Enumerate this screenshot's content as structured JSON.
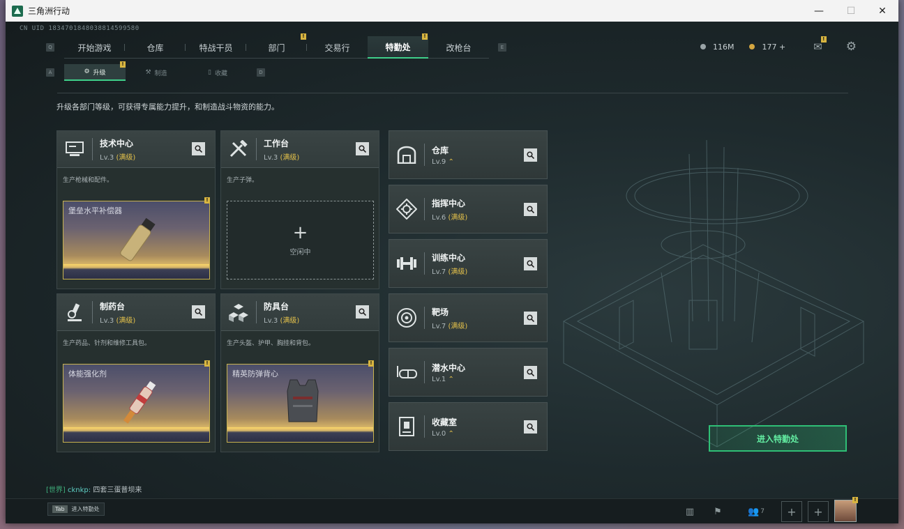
{
  "window": {
    "title": "三角洲行动"
  },
  "uid": "CN UID 1834701848038814599580",
  "nav": {
    "items": [
      {
        "label": "开始游戏"
      },
      {
        "label": "仓库"
      },
      {
        "label": "特战干员"
      },
      {
        "label": "部门"
      },
      {
        "label": "交易行"
      },
      {
        "label": "特勤处"
      },
      {
        "label": "改枪台"
      }
    ],
    "key_left": "Q",
    "key_right": "E"
  },
  "subnav": {
    "items": [
      {
        "label": "升级"
      },
      {
        "label": "制造"
      },
      {
        "label": "收藏"
      }
    ],
    "key_left": "A",
    "key_right": "D"
  },
  "currency": {
    "coins": "116M",
    "gold": "177 +"
  },
  "badge_text": "!",
  "intro": "升级各部门等级，可获得专属能力提升，和制造战斗物资的能力。",
  "cards": [
    {
      "name": "技术中心",
      "lv": "Lv.3",
      "max": "(满级)",
      "desc": "生产枪械和配件。",
      "slot": "堡垒水平补偿器"
    },
    {
      "name": "工作台",
      "lv": "Lv.3",
      "max": "(满级)",
      "desc": "生产子弹。",
      "slot_plus": "+",
      "slot_idle": "空闲中"
    },
    {
      "name": "制药台",
      "lv": "Lv.3",
      "max": "(满级)",
      "desc": "生产药品、针剂和维修工具包。",
      "slot": "体能强化剂"
    },
    {
      "name": "防具台",
      "lv": "Lv.3",
      "max": "(满级)",
      "desc": "生产头盔、护甲、胸挂和背包。",
      "slot": "精英防弹背心"
    }
  ],
  "right_cards": [
    {
      "name": "仓库",
      "lv": "Lv.9",
      "max": ""
    },
    {
      "name": "指挥中心",
      "lv": "Lv.6",
      "max": "(满级)"
    },
    {
      "name": "训练中心",
      "lv": "Lv.7",
      "max": "(满级)"
    },
    {
      "name": "靶场",
      "lv": "Lv.7",
      "max": "(满级)"
    },
    {
      "name": "潜水中心",
      "lv": "Lv.1",
      "max": ""
    },
    {
      "name": "收藏室",
      "lv": "Lv.0",
      "max": ""
    }
  ],
  "enter_button": "进入特勤处",
  "chat": {
    "channel": "[世界]",
    "user": "cknkp:",
    "message": "四套三蛋普坝来"
  },
  "tab_hint": {
    "key": "Tab",
    "label": "进入特勤处"
  },
  "friends_count": "7",
  "colors": {
    "accent": "#3fd08a",
    "gold": "#e5c24b",
    "bg": "#1b2326"
  }
}
